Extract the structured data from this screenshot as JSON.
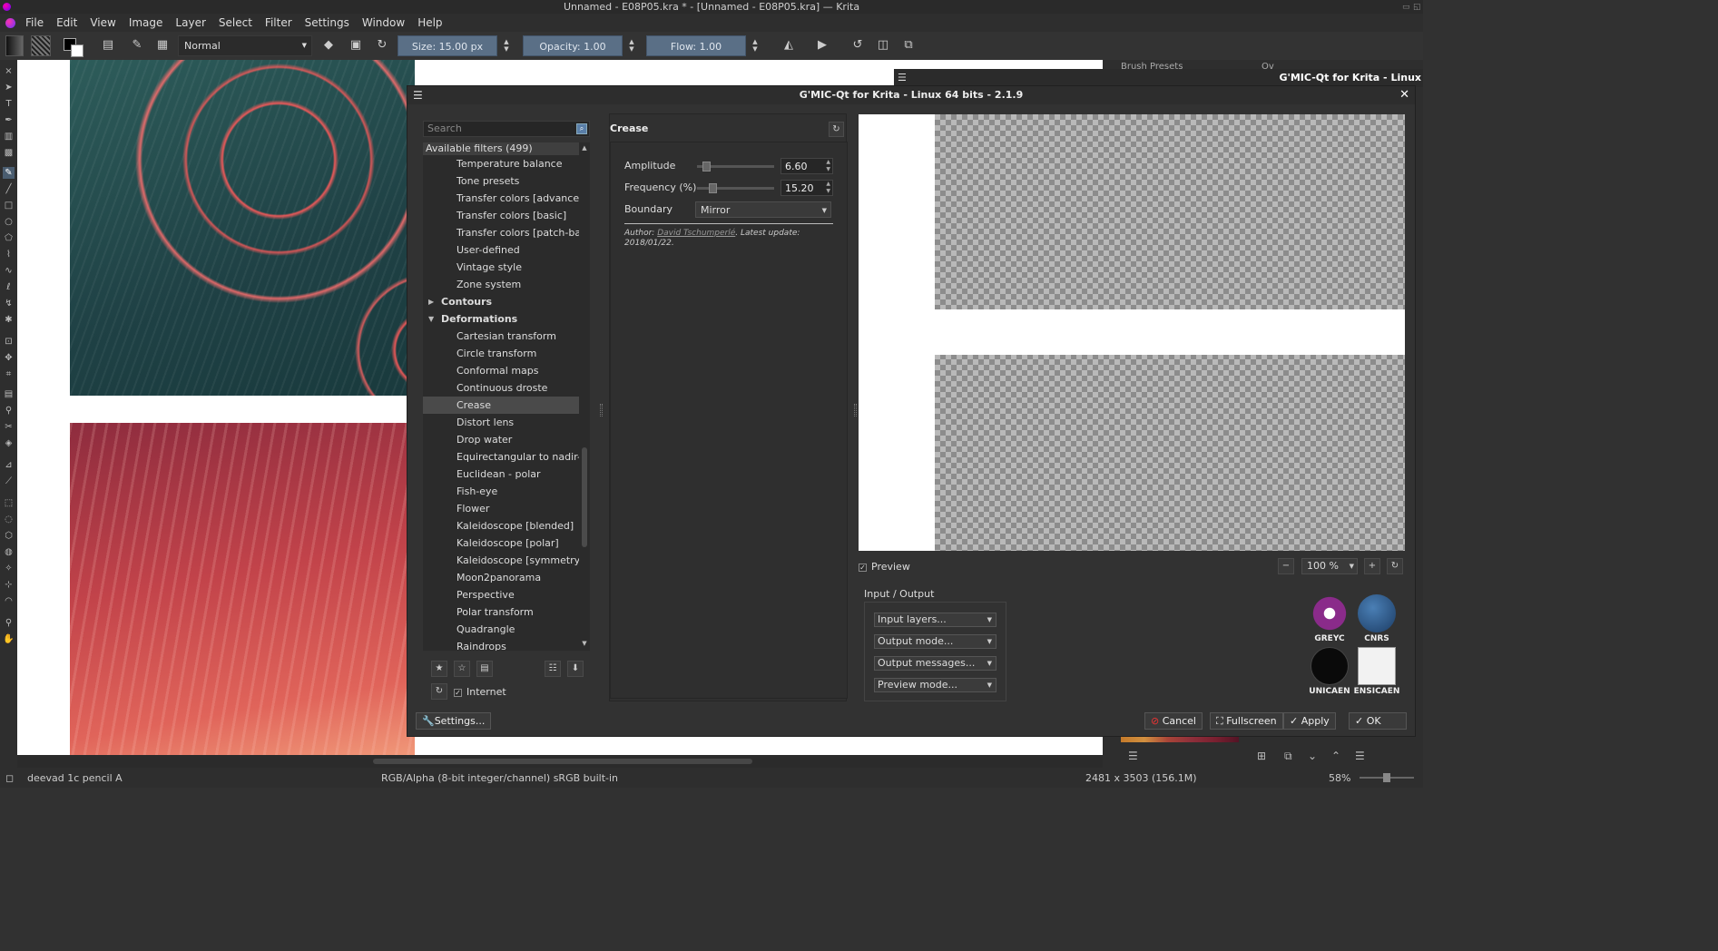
{
  "window": {
    "title": "Unnamed - E08P05.kra * - [Unnamed - E08P05.kra] — Krita"
  },
  "menu": [
    "File",
    "Edit",
    "View",
    "Image",
    "Layer",
    "Select",
    "Filter",
    "Settings",
    "Window",
    "Help"
  ],
  "toolbar": {
    "blend_mode": "Normal",
    "size": "Size:  15.00 px",
    "opacity": "Opacity:  1.00",
    "flow": "Flow:  1.00"
  },
  "gmic": {
    "dialog_title": "G'MIC-Qt for Krita - Linux 64 bits - 2.1.9",
    "outer_title": "G'MIC-Qt for Krita - Linux",
    "search_placeholder": "Search",
    "filters_header": "Available filters (499)",
    "tree": [
      {
        "label": "Temperature balance",
        "kind": "leaf"
      },
      {
        "label": "Tone presets",
        "kind": "leaf"
      },
      {
        "label": "Transfer colors [advanced]",
        "kind": "leaf"
      },
      {
        "label": "Transfer colors [basic]",
        "kind": "leaf"
      },
      {
        "label": "Transfer colors [patch-base",
        "kind": "leaf"
      },
      {
        "label": "User-defined",
        "kind": "leaf"
      },
      {
        "label": "Vintage style",
        "kind": "leaf"
      },
      {
        "label": "Zone system",
        "kind": "leaf"
      },
      {
        "label": "Contours",
        "kind": "folder",
        "open": false
      },
      {
        "label": "Deformations",
        "kind": "folder",
        "open": true
      },
      {
        "label": "Cartesian transform",
        "kind": "leaf"
      },
      {
        "label": "Circle transform",
        "kind": "leaf"
      },
      {
        "label": "Conformal maps",
        "kind": "leaf"
      },
      {
        "label": "Continuous droste",
        "kind": "leaf"
      },
      {
        "label": "Crease",
        "kind": "leaf",
        "selected": true
      },
      {
        "label": "Distort lens",
        "kind": "leaf"
      },
      {
        "label": "Drop water",
        "kind": "leaf"
      },
      {
        "label": "Equirectangular to nadir-ze",
        "kind": "leaf"
      },
      {
        "label": "Euclidean - polar",
        "kind": "leaf"
      },
      {
        "label": "Fish-eye",
        "kind": "leaf"
      },
      {
        "label": "Flower",
        "kind": "leaf"
      },
      {
        "label": "Kaleidoscope [blended]",
        "kind": "leaf"
      },
      {
        "label": "Kaleidoscope [polar]",
        "kind": "leaf"
      },
      {
        "label": "Kaleidoscope [symmetry]",
        "kind": "leaf"
      },
      {
        "label": "Moon2panorama",
        "kind": "leaf"
      },
      {
        "label": "Perspective",
        "kind": "leaf"
      },
      {
        "label": "Polar transform",
        "kind": "leaf"
      },
      {
        "label": "Quadrangle",
        "kind": "leaf"
      },
      {
        "label": "Raindrops",
        "kind": "leaf"
      }
    ],
    "internet_label": "Internet",
    "settings_label": "Settings...",
    "filter_name": "Crease",
    "params": {
      "amplitude_label": "Amplitude",
      "amplitude_value": "6.60",
      "amplitude_fraction": 0.066,
      "frequency_label": "Frequency (%)",
      "frequency_value": "15.20",
      "frequency_fraction": 0.15,
      "boundary_label": "Boundary",
      "boundary_value": "Mirror"
    },
    "author_prefix": "Author: ",
    "author_name": "David Tschumperlé",
    "author_suffix": ". Latest update: 2018/01/22.",
    "preview_label": "Preview",
    "zoom_value": "100 %",
    "io_label": "Input / Output",
    "io_selects": [
      "Input layers...",
      "Output mode...",
      "Output messages...",
      "Preview mode..."
    ],
    "logos": [
      "GREYC",
      "CNRS",
      "UNICAEN",
      "ENSICAEN"
    ],
    "buttons": {
      "cancel": "Cancel",
      "fullscreen": "Fullscreen",
      "apply": "Apply",
      "ok": "OK"
    }
  },
  "dock": {
    "brush_presets": "Brush Presets",
    "ov": "Ov"
  },
  "status": {
    "brush": "deevad 1c pencil A",
    "color": "RGB/Alpha (8-bit integer/channel)  sRGB built-in",
    "size": "2481 x 3503 (156.1M)",
    "zoom": "58%"
  }
}
